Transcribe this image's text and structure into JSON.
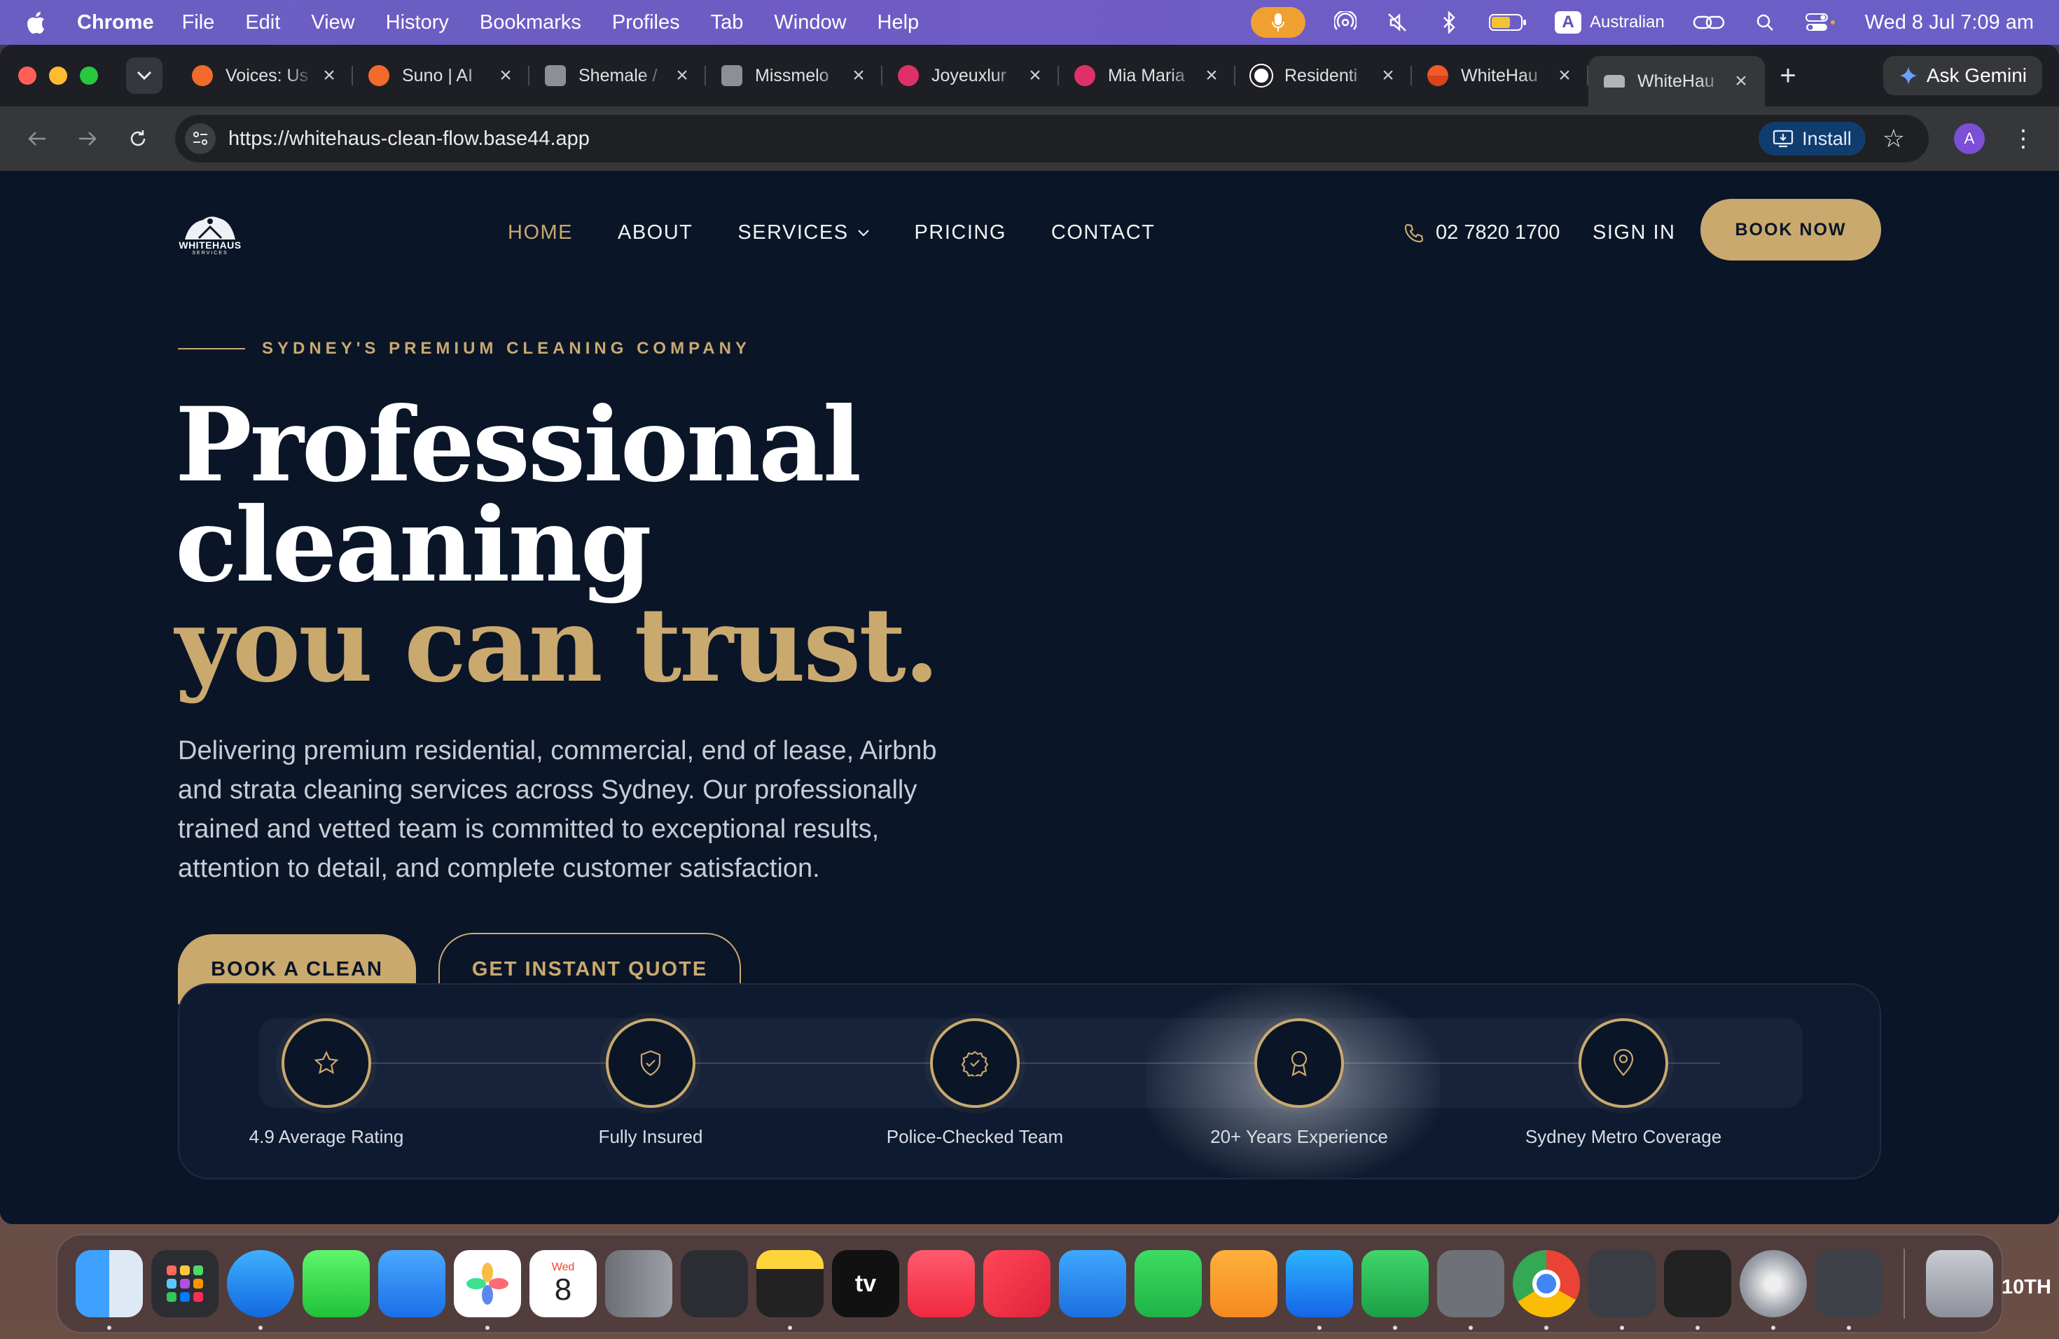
{
  "menubar": {
    "app": "Chrome",
    "items": [
      "File",
      "Edit",
      "View",
      "History",
      "Bookmarks",
      "Profiles",
      "Tab",
      "Window",
      "Help"
    ],
    "input_source": "Australian",
    "input_badge": "A",
    "datetime": "Wed 8 Jul  7:09 am"
  },
  "browser": {
    "tabs": [
      {
        "title": "Voices: Us",
        "color": "#f26b2a"
      },
      {
        "title": "Suno | AI",
        "color": "#f26b2a"
      },
      {
        "title": "Shemale /",
        "color": "#8a8f98"
      },
      {
        "title": "Missmelo",
        "color": "#8a8f98"
      },
      {
        "title": "Joyeuxlur",
        "color": "#e0306a"
      },
      {
        "title": "Mia Maria",
        "color": "#e0306a"
      },
      {
        "title": "Residenti",
        "color": "#ffffff"
      },
      {
        "title": "WhiteHau",
        "color": "#f05a28"
      },
      {
        "title": "WhiteHau",
        "color": "#b0b4ba",
        "active": true
      }
    ],
    "new_tab_icon": "+",
    "gemini_label": "Ask Gemini",
    "url": "https://whitehaus-clean-flow.base44.app",
    "install_label": "Install",
    "avatar_letter": "A"
  },
  "site": {
    "logo": {
      "name": "WHITEHAUS",
      "sub": "SERVICES"
    },
    "nav": {
      "home": "HOME",
      "about": "ABOUT",
      "services": "SERVICES",
      "pricing": "PRICING",
      "contact": "CONTACT"
    },
    "phone": "02 7820 1700",
    "sign_in": "SIGN IN",
    "book_now": "BOOK NOW",
    "eyebrow": "SYDNEY'S PREMIUM CLEANING COMPANY",
    "headline": {
      "line1": "Professional",
      "line2": "cleaning",
      "line3": "you can trust."
    },
    "lead": "Delivering premium residential, commercial, end of lease, Airbnb and strata cleaning services across Sydney. Our professionally trained and vetted team is committed to exceptional results, attention to detail, and complete customer satisfaction.",
    "cta_primary": "BOOK A CLEAN",
    "cta_secondary": "GET INSTANT QUOTE",
    "trust": [
      {
        "label": "4.9 Average Rating",
        "icon": "star-icon"
      },
      {
        "label": "Fully Insured",
        "icon": "shield-icon"
      },
      {
        "label": "Police-Checked Team",
        "icon": "badge-check-icon"
      },
      {
        "label": "20+ Years Experience",
        "icon": "award-icon"
      },
      {
        "label": "Sydney Metro Coverage",
        "icon": "map-pin-icon"
      }
    ],
    "accent_color": "#c9a96e",
    "background_color": "#0b1528"
  },
  "dock": {
    "calendar_month": "Wed",
    "calendar_day": "8",
    "tv_label": "tv",
    "tenth_label": "10TH"
  }
}
